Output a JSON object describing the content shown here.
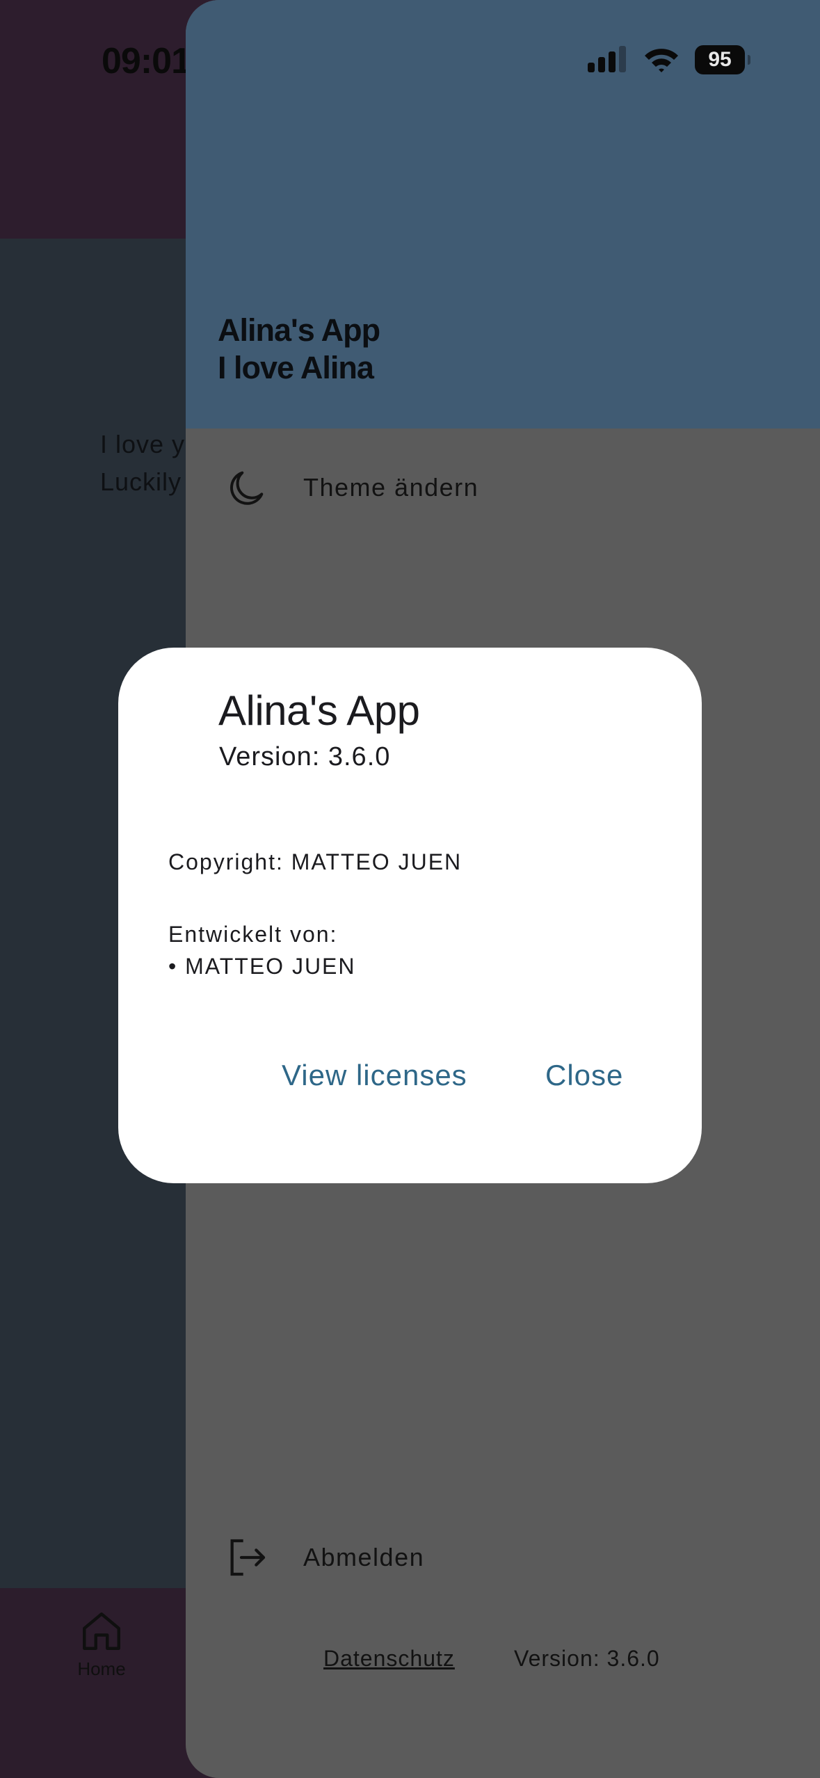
{
  "status_bar": {
    "time": "09:01",
    "battery": "95"
  },
  "background": {
    "line1": "I love y",
    "line2": "Luckily",
    "nav_home_label": "Home"
  },
  "drawer": {
    "header_line1": "Alina's App",
    "header_line2": "I love Alina",
    "items": [
      {
        "label": "Theme ändern",
        "icon": "moon-icon"
      },
      {
        "label": "Abmelden",
        "icon": "logout-icon"
      }
    ],
    "footer": {
      "privacy_link": "Datenschutz",
      "version": "Version: 3.6.0"
    }
  },
  "dialog": {
    "title": "Alina's App",
    "version": "Version: 3.6.0",
    "copyright": "Copyright: MATTEO JUEN",
    "developed_by_heading": "Entwickelt von:",
    "developers": [
      "• MATTEO JUEN"
    ],
    "buttons": {
      "view_licenses": "View licenses",
      "close": "Close"
    }
  },
  "colors": {
    "drawer_header": "#405b73",
    "drawer_body": "#5b5b5b",
    "dialog_button": "#2e6788",
    "background_main": "#272f37",
    "background_top": "#2d1d2d"
  }
}
